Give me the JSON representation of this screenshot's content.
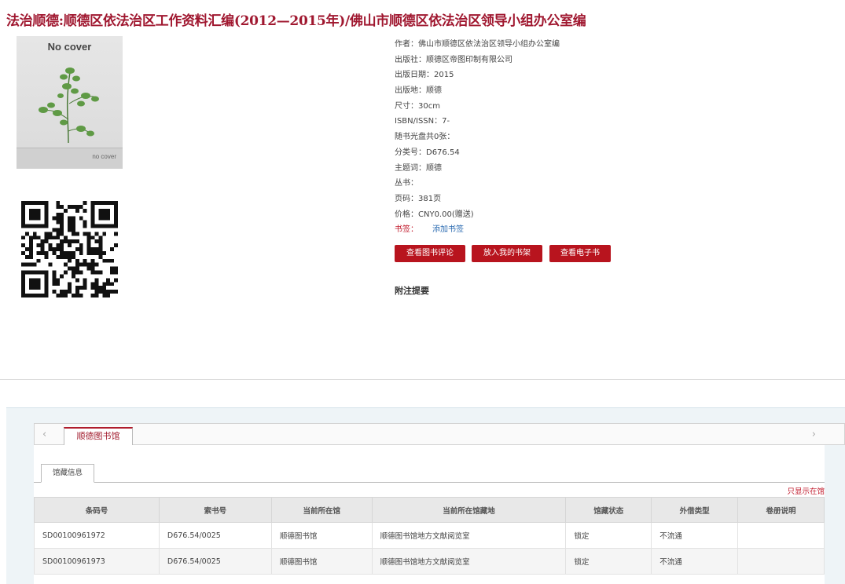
{
  "book": {
    "title": "法治顺德:顺德区依法治区工作资料汇编(2012—2015年)/佛山市顺德区依法治区领导小组办公室编",
    "cover_title": "No cover",
    "cover_sub": "no cover"
  },
  "info": {
    "author": "作者：佛山市顺德区依法治区领导小组办公室编",
    "publisher": "出版社：顺德区帝图印制有限公司",
    "pub_date": "出版日期：2015",
    "pub_place": "出版地：顺德",
    "size": "尺寸：30cm",
    "isbn": "ISBN/ISSN：7-",
    "cd": "随书光盘共0张：",
    "class_no": "分类号：D676.54",
    "subject": "主题词：顺德",
    "series": "丛书：",
    "pages": "页码：381页",
    "price": "价格：CNY0.00(赠送)",
    "tag_label": "书签：",
    "tag_add": "添加书签"
  },
  "buttons": {
    "reviews": "查看图书评论",
    "shelf": "放入我的书架",
    "ebook": "查看电子书"
  },
  "annotation_label": "附注提要",
  "holdings": {
    "library_tab": "顺德图书馆",
    "sub_tab": "馆藏信息",
    "only_show": "只显示在馆",
    "prev_arrow": "‹",
    "next_arrow": "›",
    "columns": [
      "条码号",
      "索书号",
      "当前所在馆",
      "当前所在馆藏地",
      "馆藏状态",
      "外借类型",
      "卷册说明"
    ],
    "rows": [
      [
        "SD00100961972",
        "D676.54/0025",
        "顺德图书馆",
        "顺德图书馆地方文献阅览室",
        "锁定",
        "不流通",
        ""
      ],
      [
        "SD00100961973",
        "D676.54/0025",
        "顺德图书馆",
        "顺德图书馆地方文献阅览室",
        "锁定",
        "不流通",
        ""
      ]
    ]
  },
  "colors": {
    "title": "#a01830",
    "button": "#b8141e",
    "link": "#2a6ab0"
  },
  "icons": {
    "cover": "plant-cover-image",
    "qr": "qr-code"
  }
}
